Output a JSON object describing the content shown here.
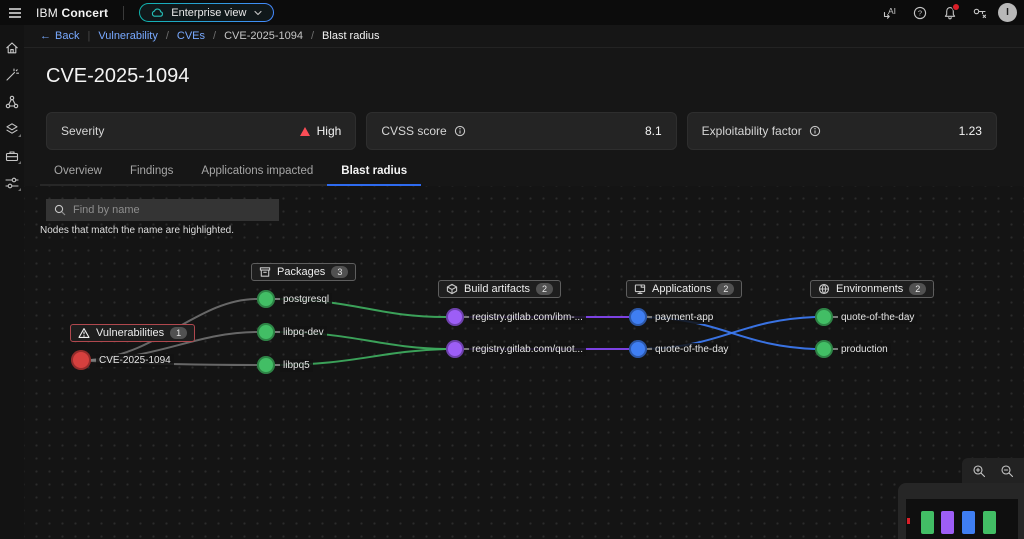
{
  "header": {
    "brand_prefix": "IBM",
    "brand_name": "Concert",
    "view_switcher_label": "Enterprise view",
    "avatar_initial": "I"
  },
  "breadcrumb": {
    "back_label": "Back",
    "divider": "|",
    "separator": "/",
    "items": [
      "Vulnerability",
      "CVEs",
      "CVE-2025-1094",
      "Blast radius"
    ]
  },
  "page_title": "CVE-2025-1094",
  "metrics": [
    {
      "label": "Severity",
      "value": "High",
      "icon_color": "#fa4d56"
    },
    {
      "label": "CVSS score",
      "value": "8.1"
    },
    {
      "label": "Exploitability factor",
      "value": "1.23"
    }
  ],
  "tabs": [
    {
      "label": "Overview"
    },
    {
      "label": "Findings"
    },
    {
      "label": "Applications impacted"
    },
    {
      "label": "Blast radius"
    }
  ],
  "blast_radius": {
    "search_placeholder": "Find by name",
    "hint": "Nodes that match the name are highlighted."
  },
  "graph": {
    "groups": [
      {
        "label": "Vulnerabilities",
        "count": "1",
        "border": "#b0484e"
      },
      {
        "label": "Packages",
        "count": "3",
        "border": "#5e5e5e"
      },
      {
        "label": "Build artifacts",
        "count": "2",
        "border": "#5e5e5e"
      },
      {
        "label": "Applications",
        "count": "2",
        "border": "#5e5e5e"
      },
      {
        "label": "Environments",
        "count": "2",
        "border": "#5e5e5e"
      }
    ],
    "nodes": [
      {
        "label": "CVE-2025-1094",
        "type": "vulnerability",
        "color": "#d5403e"
      },
      {
        "label": "postgresql",
        "type": "package",
        "color": "#42be65"
      },
      {
        "label": "libpq-dev",
        "type": "package",
        "color": "#42be65"
      },
      {
        "label": "libpq5",
        "type": "package",
        "color": "#42be65"
      },
      {
        "label": "registry.gitlab.com/ibm-...",
        "type": "build-artifact",
        "color": "#9d5ef6"
      },
      {
        "label": "registry.gitlab.com/quot...",
        "type": "build-artifact",
        "color": "#9d5ef6"
      },
      {
        "label": "payment-app",
        "type": "application",
        "color": "#3f7ef2"
      },
      {
        "label": "quote-of-the-day",
        "type": "application",
        "color": "#3f7ef2"
      },
      {
        "label": "quote-of-the-day",
        "type": "environment",
        "color": "#42be65"
      },
      {
        "label": "production",
        "type": "environment",
        "color": "#42be65"
      }
    ],
    "edges": [
      {
        "from": "CVE-2025-1094",
        "to": "postgresql",
        "color": "#6f6f6f"
      },
      {
        "from": "CVE-2025-1094",
        "to": "libpq-dev",
        "color": "#6f6f6f"
      },
      {
        "from": "CVE-2025-1094",
        "to": "libpq5",
        "color": "#6f6f6f"
      },
      {
        "from": "postgresql",
        "to": "registry.gitlab.com/ibm-...",
        "color": "#3fae5f"
      },
      {
        "from": "libpq-dev",
        "to": "registry.gitlab.com/quot...",
        "color": "#3fae5f"
      },
      {
        "from": "libpq5",
        "to": "registry.gitlab.com/quot...",
        "color": "#3fae5f"
      },
      {
        "from": "registry.gitlab.com/ibm-...",
        "to": "payment-app",
        "color": "#8646f4"
      },
      {
        "from": "registry.gitlab.com/quot...",
        "to": "quote-of-the-day",
        "color": "#8646f4"
      },
      {
        "from": "payment-app",
        "to": "production",
        "color": "#3d7bf4"
      },
      {
        "from": "quote-of-the-day",
        "to": "quote-of-the-day",
        "color": "#3d7bf4"
      }
    ]
  },
  "minimap": {
    "marker_color": "#da1e28",
    "blocks": [
      {
        "color": "#42be65"
      },
      {
        "color": "#9d5ef6"
      },
      {
        "color": "#3f7ef2"
      },
      {
        "color": "#42be65"
      }
    ]
  }
}
